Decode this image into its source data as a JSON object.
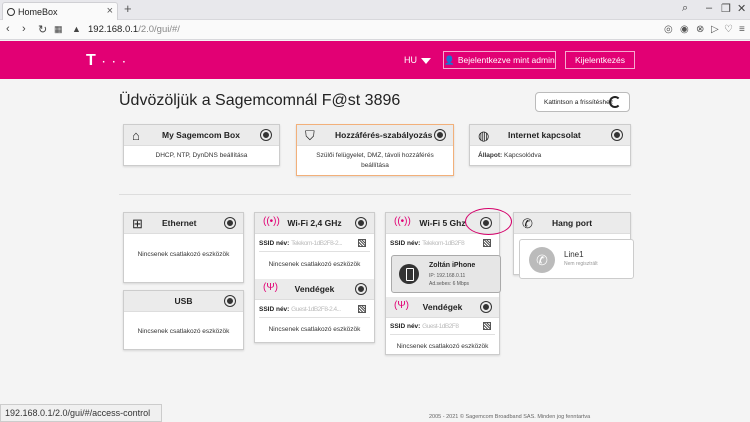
{
  "browser": {
    "tab_title": "HomeBox",
    "url_host": "192.168.0.1",
    "url_path": "/2.0/gui/#/",
    "status_url": "192.168.0.1/2.0/gui/#/access-control"
  },
  "header": {
    "logo_t": "T",
    "logo_dots": "· · ·",
    "language": "HU",
    "user_label": "Bejelentkezve mint  admin",
    "logout_label": "Kijelentkezés"
  },
  "main": {
    "welcome": "Üdvözöljük a Sagemcomnál F@st 3896",
    "refresh_label": "Kattintson a frissítéshez"
  },
  "top_cards": {
    "my_box": {
      "title": "My Sagemcom Box",
      "body": "DHCP, NTP, DynDNS beállítása"
    },
    "access": {
      "title": "Hozzáférés-szabályozás",
      "body": "Szülői felügyelet, DMZ, távoli hozzáférés beállítása"
    },
    "internet": {
      "title": "Internet kapcsolat",
      "status_label": "Állapot:",
      "status_value": "Kapcsolódva"
    }
  },
  "ethernet": {
    "title": "Ethernet",
    "msg": "Nincsenek csatlakozó eszközök"
  },
  "usb": {
    "title": "USB",
    "msg": "Nincsenek csatlakozó eszközök"
  },
  "wifi24": {
    "title": "Wi-Fi 2,4 GHz",
    "ssid_label": "SSID név:",
    "ssid_value": "Telekom-1dB2F8-2...",
    "msg": "Nincsenek csatlakozó eszközök",
    "guest_title": "Vendégek",
    "guest_ssid_value": "Guest-1dB2F8-2.4...",
    "guest_msg": "Nincsenek csatlakozó eszközök"
  },
  "wifi5": {
    "title": "Wi-Fi 5 Ghz",
    "ssid_label": "SSID név:",
    "ssid_value": "Telekom-1dB2F8",
    "device_name": "Zoltán iPhone",
    "device_ip": "IP: 192.168.0.11",
    "device_speed": "Ad.sebes: 6 Mbps",
    "guest_title": "Vendégek",
    "guest_ssid_value": "Guest-1dB2F8",
    "guest_msg": "Nincsenek csatlakozó eszközök"
  },
  "phone": {
    "title": "Hang port",
    "line_name": "Line1",
    "line_status": "Nem regisztrált"
  },
  "footer": {
    "text": "2005 - 2021 © Sagemcom Broadband SAS. Minden jog fenntartva"
  },
  "colors": {
    "brand": "#e20074"
  }
}
